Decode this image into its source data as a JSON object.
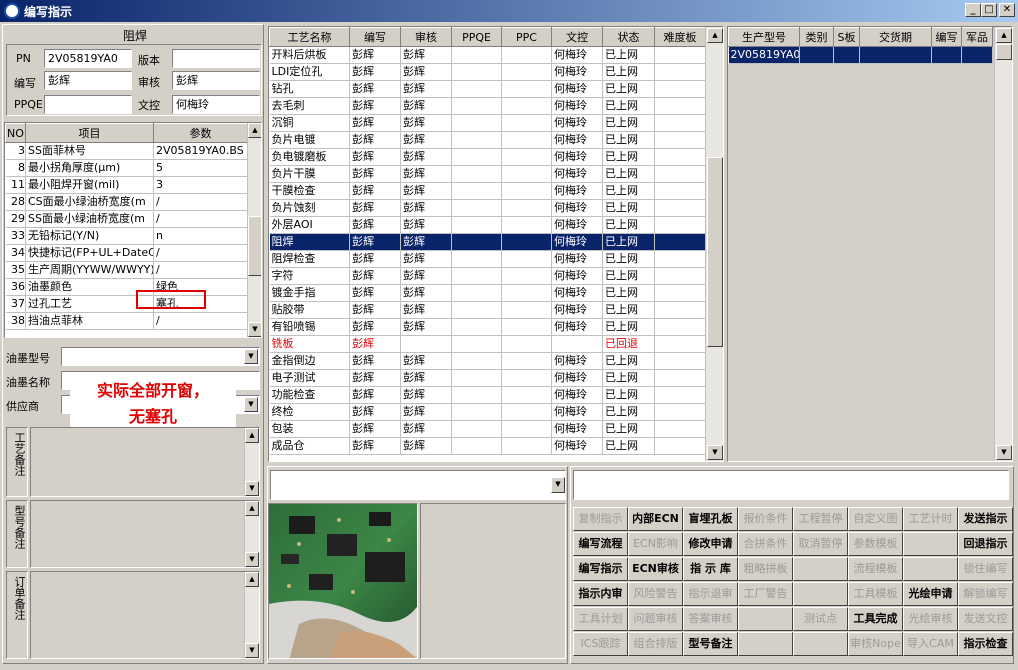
{
  "window": {
    "title": "编写指示",
    "min": "_",
    "max": "□",
    "close": "✕"
  },
  "info": {
    "header": "阻焊",
    "pn_label": "PN",
    "pn_value": "2V05819YA0",
    "version_label": "版本",
    "version_value": "",
    "writer_label": "编写",
    "writer_value": "彭辉",
    "reviewer_label": "审核",
    "reviewer_value": "彭辉",
    "ppqe_label": "PPQE",
    "ppqe_value": "",
    "docctrl_label": "文控",
    "docctrl_value": "何梅玲"
  },
  "params": {
    "headers": [
      "NO",
      "项目",
      "参数"
    ],
    "rows": [
      {
        "no": "3",
        "item": "SS面菲林号",
        "value": "2V05819YA0.BS"
      },
      {
        "no": "8",
        "item": "最小拐角厚度(μm)",
        "value": "5"
      },
      {
        "no": "11",
        "item": "最小阻焊开窗(mil)",
        "value": "3"
      },
      {
        "no": "28",
        "item": "CS面最小绿油桥宽度(m",
        "value": "/"
      },
      {
        "no": "29",
        "item": "SS面最小绿油桥宽度(m",
        "value": "/"
      },
      {
        "no": "33",
        "item": "无铅标记(Y/N)",
        "value": "n"
      },
      {
        "no": "34",
        "item": "快捷标记(FP+UL+DateCo",
        "value": "/"
      },
      {
        "no": "35",
        "item": "生产周期(YYWW/WWYY)",
        "value": "/"
      },
      {
        "no": "36",
        "item": "油墨颜色",
        "value": "绿色"
      },
      {
        "no": "37",
        "item": "过孔工艺",
        "value": "塞孔"
      },
      {
        "no": "38",
        "item": "挡油点菲林",
        "value": "/"
      }
    ]
  },
  "ink": {
    "type_label": "油墨型号",
    "name_label": "油墨名称",
    "supplier_label": "供应商"
  },
  "annotation": {
    "line1": "实际全部开窗，",
    "line2": "无塞孔"
  },
  "notes": {
    "process": "工艺备注",
    "model": "型号备注",
    "order": "订单备注"
  },
  "process_table": {
    "headers": [
      "工艺名称",
      "编写",
      "审核",
      "PPQE",
      "PPC",
      "文控",
      "状态",
      "难度板"
    ],
    "rows": [
      {
        "name": "开料后烘板",
        "w": "彭辉",
        "r": "彭辉",
        "p": "",
        "c": "",
        "d": "何梅玲",
        "s": "已上网",
        "h": ""
      },
      {
        "name": "LDI定位孔",
        "w": "彭辉",
        "r": "彭辉",
        "p": "",
        "c": "",
        "d": "何梅玲",
        "s": "已上网",
        "h": ""
      },
      {
        "name": "钻孔",
        "w": "彭辉",
        "r": "彭辉",
        "p": "",
        "c": "",
        "d": "何梅玲",
        "s": "已上网",
        "h": ""
      },
      {
        "name": "去毛刺",
        "w": "彭辉",
        "r": "彭辉",
        "p": "",
        "c": "",
        "d": "何梅玲",
        "s": "已上网",
        "h": ""
      },
      {
        "name": "沉铜",
        "w": "彭辉",
        "r": "彭辉",
        "p": "",
        "c": "",
        "d": "何梅玲",
        "s": "已上网",
        "h": ""
      },
      {
        "name": "负片电镀",
        "w": "彭辉",
        "r": "彭辉",
        "p": "",
        "c": "",
        "d": "何梅玲",
        "s": "已上网",
        "h": ""
      },
      {
        "name": "负电镀磨板",
        "w": "彭辉",
        "r": "彭辉",
        "p": "",
        "c": "",
        "d": "何梅玲",
        "s": "已上网",
        "h": ""
      },
      {
        "name": "负片干膜",
        "w": "彭辉",
        "r": "彭辉",
        "p": "",
        "c": "",
        "d": "何梅玲",
        "s": "已上网",
        "h": ""
      },
      {
        "name": "干膜检查",
        "w": "彭辉",
        "r": "彭辉",
        "p": "",
        "c": "",
        "d": "何梅玲",
        "s": "已上网",
        "h": ""
      },
      {
        "name": "负片蚀刻",
        "w": "彭辉",
        "r": "彭辉",
        "p": "",
        "c": "",
        "d": "何梅玲",
        "s": "已上网",
        "h": ""
      },
      {
        "name": "外层AOI",
        "w": "彭辉",
        "r": "彭辉",
        "p": "",
        "c": "",
        "d": "何梅玲",
        "s": "已上网",
        "h": ""
      },
      {
        "name": "阻焊",
        "w": "彭辉",
        "r": "彭辉",
        "p": "",
        "c": "",
        "d": "何梅玲",
        "s": "已上网",
        "h": ""
      },
      {
        "name": "阻焊检查",
        "w": "彭辉",
        "r": "彭辉",
        "p": "",
        "c": "",
        "d": "何梅玲",
        "s": "已上网",
        "h": ""
      },
      {
        "name": "字符",
        "w": "彭辉",
        "r": "彭辉",
        "p": "",
        "c": "",
        "d": "何梅玲",
        "s": "已上网",
        "h": ""
      },
      {
        "name": "镀金手指",
        "w": "彭辉",
        "r": "彭辉",
        "p": "",
        "c": "",
        "d": "何梅玲",
        "s": "已上网",
        "h": ""
      },
      {
        "name": "贴胶带",
        "w": "彭辉",
        "r": "彭辉",
        "p": "",
        "c": "",
        "d": "何梅玲",
        "s": "已上网",
        "h": ""
      },
      {
        "name": "有铅喷锡",
        "w": "彭辉",
        "r": "彭辉",
        "p": "",
        "c": "",
        "d": "何梅玲",
        "s": "已上网",
        "h": ""
      },
      {
        "name": "铣板",
        "w": "彭辉",
        "r": "",
        "p": "",
        "c": "",
        "d": "",
        "s": "已回退",
        "h": ""
      },
      {
        "name": "金指倒边",
        "w": "彭辉",
        "r": "彭辉",
        "p": "",
        "c": "",
        "d": "何梅玲",
        "s": "已上网",
        "h": ""
      },
      {
        "name": "电子测试",
        "w": "彭辉",
        "r": "彭辉",
        "p": "",
        "c": "",
        "d": "何梅玲",
        "s": "已上网",
        "h": ""
      },
      {
        "name": "功能检查",
        "w": "彭辉",
        "r": "彭辉",
        "p": "",
        "c": "",
        "d": "何梅玲",
        "s": "已上网",
        "h": ""
      },
      {
        "name": "终检",
        "w": "彭辉",
        "r": "彭辉",
        "p": "",
        "c": "",
        "d": "何梅玲",
        "s": "已上网",
        "h": ""
      },
      {
        "name": "包装",
        "w": "彭辉",
        "r": "彭辉",
        "p": "",
        "c": "",
        "d": "何梅玲",
        "s": "已上网",
        "h": ""
      },
      {
        "name": "成品仓",
        "w": "彭辉",
        "r": "彭辉",
        "p": "",
        "c": "",
        "d": "何梅玲",
        "s": "已上网",
        "h": ""
      }
    ],
    "selected_index": 11,
    "red_index": 17
  },
  "model_table": {
    "headers": [
      "生产型号",
      "类别",
      "S板",
      "交货期",
      "编写",
      "军品"
    ],
    "rows": [
      {
        "model": "2V05819YA0",
        "cat": "",
        "s": "",
        "due": "",
        "w": "",
        "mil": ""
      }
    ]
  },
  "buttons": [
    [
      "复制指示",
      "内部ECN",
      "盲埋孔板",
      "报价条件",
      "工程暂停",
      "自定义图",
      "工艺计时",
      "发送指示"
    ],
    [
      "编写流程",
      "ECN影响",
      "修改申请",
      "合拼条件",
      "取消暂停",
      "参数模板",
      "",
      "回退指示"
    ],
    [
      "编写指示",
      "ECN审核",
      "指 示 库",
      "粗略拼板",
      "",
      "流程模板",
      "",
      "锁住编写"
    ],
    [
      "指示内审",
      "风险警告",
      "指示退审",
      "工厂警告",
      "",
      "工具模板",
      "光绘申请",
      "解锁编写"
    ],
    [
      "工具计划",
      "问题审核",
      "答案审核",
      "",
      "测试点",
      "工具完成",
      "光绘审核",
      "发送文控"
    ],
    [
      "ICS跟踪",
      "组合排版",
      "型号备注",
      "",
      "",
      "审核Nope",
      "导入CAM",
      "指示检查"
    ]
  ],
  "buttons_enabled": [
    [
      0,
      1,
      1,
      0,
      0,
      0,
      0,
      1
    ],
    [
      1,
      0,
      1,
      0,
      0,
      0,
      0,
      1
    ],
    [
      1,
      1,
      1,
      0,
      0,
      0,
      0,
      0
    ],
    [
      1,
      0,
      0,
      0,
      0,
      0,
      1,
      0
    ],
    [
      0,
      0,
      0,
      0,
      0,
      1,
      0,
      0
    ],
    [
      0,
      0,
      1,
      0,
      0,
      0,
      0,
      1
    ]
  ],
  "colors": {
    "selection": "#0a246a",
    "annotation": "#e00000",
    "highlight_box": "#e00000"
  }
}
